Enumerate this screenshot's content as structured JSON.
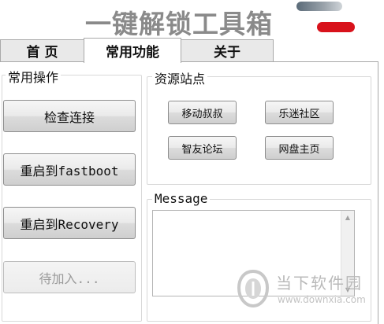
{
  "window": {
    "title": "一键解锁工具箱"
  },
  "tabs": [
    {
      "label": "首 页",
      "active": false
    },
    {
      "label": "常用功能",
      "active": true
    },
    {
      "label": "关于",
      "active": false
    }
  ],
  "common_ops": {
    "label": "常用操作",
    "buttons": [
      {
        "label": "检查连接",
        "enabled": true
      },
      {
        "label": "重启到fastboot",
        "enabled": true
      },
      {
        "label": "重启到Recovery",
        "enabled": true
      },
      {
        "label": "待加入...",
        "enabled": false
      }
    ]
  },
  "resource_sites": {
    "label": "资源站点",
    "links": [
      {
        "label": "移动叔叔"
      },
      {
        "label": "乐迷社区"
      },
      {
        "label": "智友论坛"
      },
      {
        "label": "网盘主页"
      }
    ]
  },
  "message": {
    "label": "Message",
    "content": ""
  },
  "watermark": {
    "text": "当下软件园",
    "url": "www.downxia.com"
  },
  "colors": {
    "title_gray": "#8a8a8a",
    "close_red": "#d8121b",
    "border": "#a9a9a9"
  }
}
